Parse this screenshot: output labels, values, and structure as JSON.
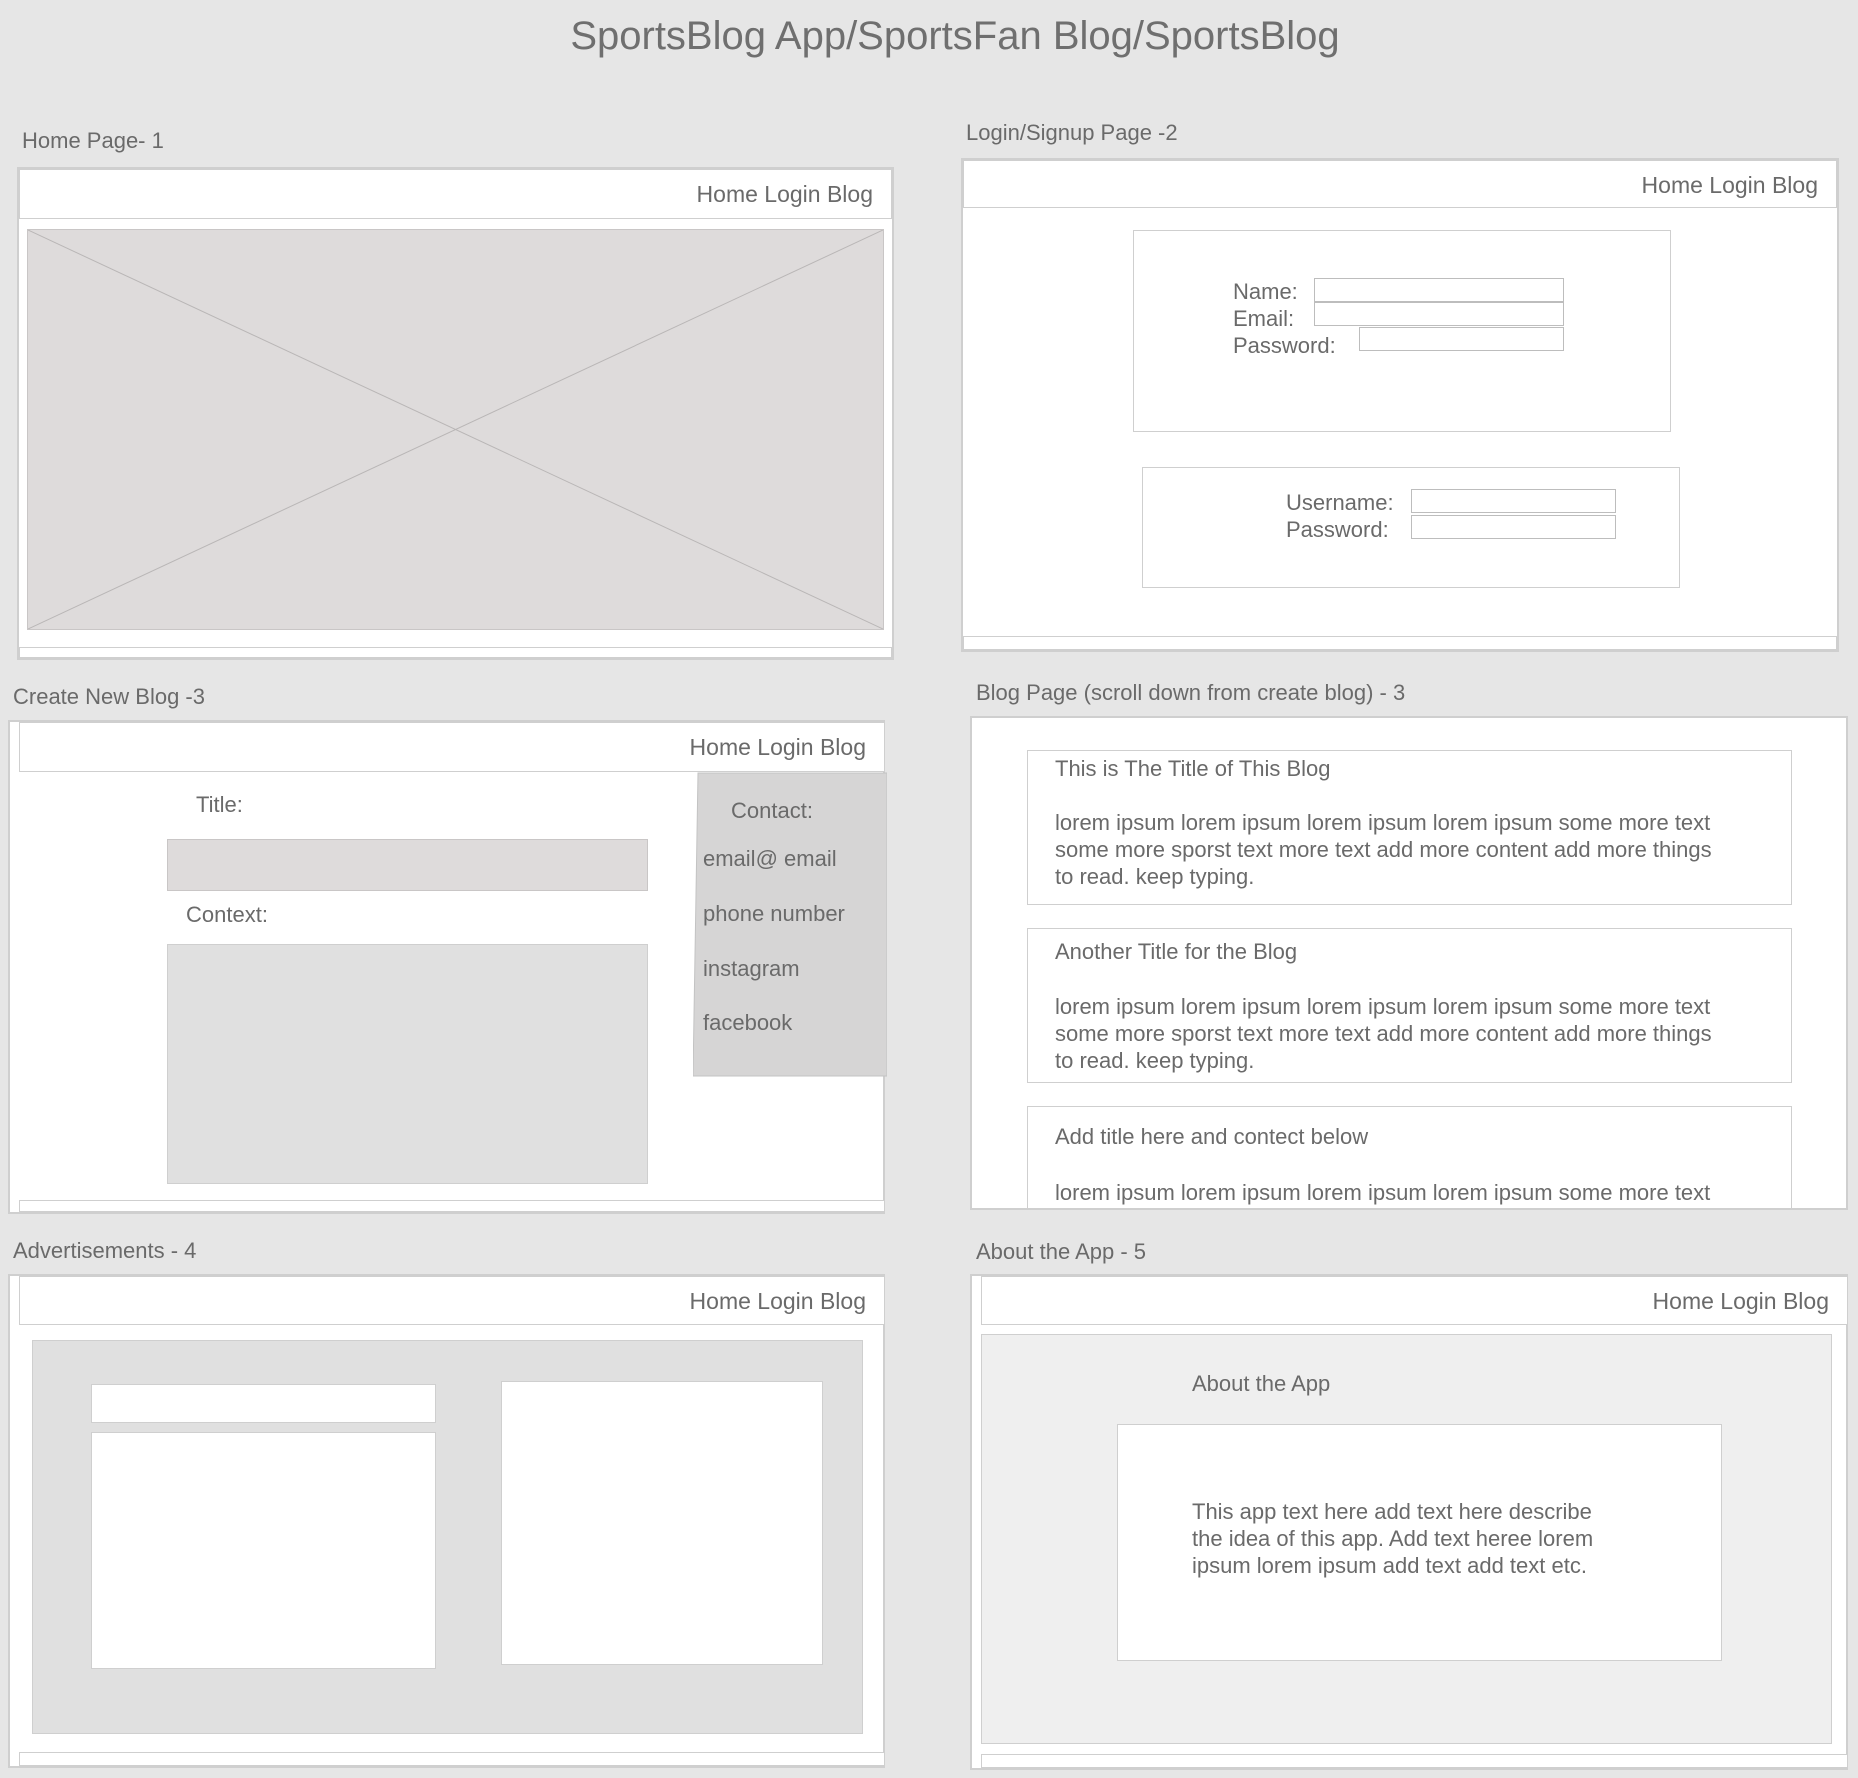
{
  "title": "SportsBlog App/SportsFan Blog/SportsBlog",
  "nav": "Home Login Blog",
  "home": {
    "label": "Home Page- 1"
  },
  "login": {
    "label": "Login/Signup Page -2",
    "name_label": "Name:",
    "email_label": "Email:",
    "password_label": "Password:",
    "username_label": "Username:",
    "password_label2": "Password:"
  },
  "create": {
    "label": "Create New Blog -3",
    "title_label": "Title:",
    "context_label": "Context:",
    "contact": {
      "heading": "Contact:",
      "items": [
        "email@ email",
        "phone number",
        "instagram",
        "facebook"
      ]
    }
  },
  "blog": {
    "label": "Blog Page (scroll down from create blog) - 3",
    "posts": [
      {
        "title": "This is The Title of This Blog",
        "lines": [
          "lorem ipsum lorem ipsum lorem ipsum lorem ipsum some more text",
          "some more sporst text more text add more content add more things",
          "to read. keep typing."
        ]
      },
      {
        "title": "Another Title for the Blog",
        "lines": [
          "lorem ipsum lorem ipsum lorem ipsum lorem ipsum some more text",
          "some more sporst text more text add more content add more things",
          "to read. keep typing."
        ]
      },
      {
        "title": "Add title here and contect below",
        "lines": [
          "lorem ipsum lorem ipsum lorem ipsum lorem ipsum some more text"
        ]
      }
    ]
  },
  "ads": {
    "label": "Advertisements - 4"
  },
  "about": {
    "label": "About the App - 5",
    "heading": "About the App",
    "lines": [
      "This app text here add text here describe",
      "the idea of this app. Add text heree lorem",
      "ipsum lorem ipsum add text add text etc."
    ]
  },
  "colors": {
    "background": "#e6e6e6",
    "placeholder": "#dedbdb",
    "border": "#cfcfcf",
    "text": "#6a6a6a"
  }
}
